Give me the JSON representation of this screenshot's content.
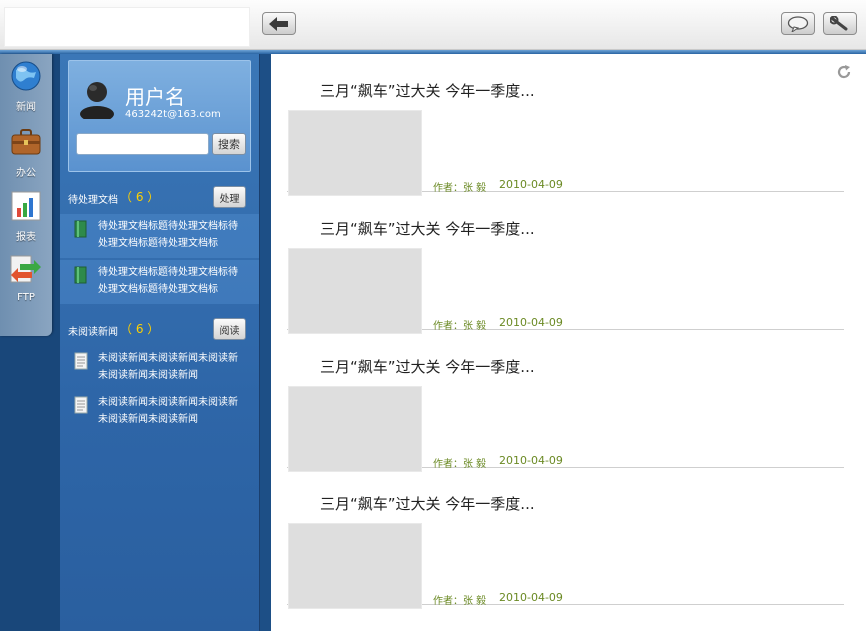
{
  "toolbar": {
    "back_icon": "arrow-left-icon",
    "chat_icon": "speech-bubble-icon",
    "settings_icon": "wrench-icon"
  },
  "nav": {
    "items": [
      {
        "label": "新闻",
        "icon": "globe-icon"
      },
      {
        "label": "办公",
        "icon": "briefcase-icon"
      },
      {
        "label": "报表",
        "icon": "bar-chart-icon"
      },
      {
        "label": "FTP",
        "icon": "ftp-transfer-icon"
      }
    ]
  },
  "user": {
    "name": "用户名",
    "email": "463242t@163.com"
  },
  "search": {
    "placeholder": "",
    "button": "搜索"
  },
  "pending": {
    "title": "待处理文档",
    "count": "（ 6 ）",
    "button": "处理",
    "items": [
      "待处理文档标题待处理文档标待处理文档标题待处理文档标",
      "待处理文档标题待处理文档标待处理文档标题待处理文档标"
    ]
  },
  "unread": {
    "title": "未阅读新闻",
    "count": "（ 6 ）",
    "button": "阅读",
    "items": [
      "未阅读新闻未阅读新闻未阅读新未阅读新闻未阅读新闻",
      "未阅读新闻未阅读新闻未阅读新未阅读新闻未阅读新闻"
    ]
  },
  "news": [
    {
      "title": "三月“飙车”过大关 今年一季度...",
      "author": "作者：张 毅",
      "date": "2010-04-09"
    },
    {
      "title": "三月“飙车”过大关 今年一季度...",
      "author": "作者：张 毅",
      "date": "2010-04-09"
    },
    {
      "title": "三月“飙车”过大关 今年一季度...",
      "author": "作者：张 毅",
      "date": "2010-04-09"
    },
    {
      "title": "三月“飙车”过大关 今年一季度...",
      "author": "作者：张 毅",
      "date": "2010-04-09"
    }
  ],
  "colors": {
    "accent_blue": "#2e66a8",
    "count_yellow": "#ffd200",
    "meta_green": "#6b8a24"
  }
}
